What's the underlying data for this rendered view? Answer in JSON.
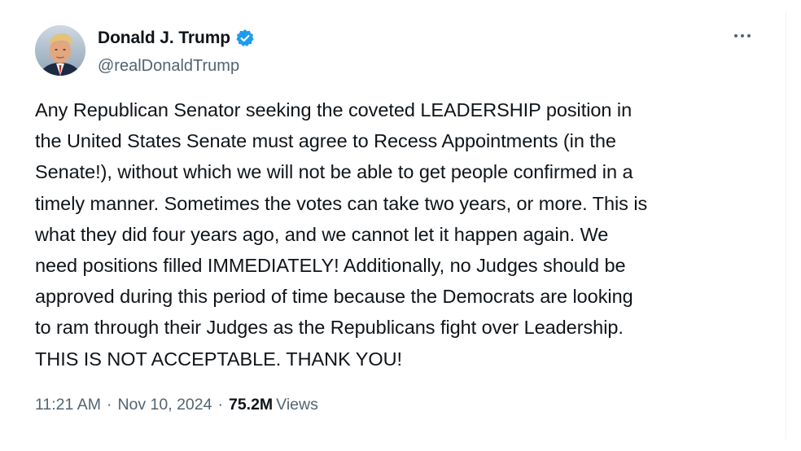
{
  "author": {
    "display_name": "Donald J. Trump",
    "handle": "@realDonaldTrump",
    "verified": true
  },
  "post": {
    "text": "Any Republican Senator seeking the coveted LEADERSHIP position in\nthe United States Senate must agree to Recess Appointments (in the\nSenate!), without which we will not be able to get people confirmed in a\ntimely manner. Sometimes the votes can take two years, or more. This is\nwhat they did four years ago, and we cannot let it happen again. We\nneed positions filled IMMEDIATELY! Additionally, no Judges should be\napproved during this period of time because the Democrats are looking\nto ram through their Judges as the Republicans fight over Leadership.\nTHIS IS NOT ACCEPTABLE. THANK YOU!",
    "time": "11:21 AM",
    "separator": "·",
    "date": "Nov 10, 2024",
    "views_count": "75.2M",
    "views_label": "Views"
  },
  "icons": {
    "more": "more-horizontal-icon",
    "verified": "verified-badge-icon"
  },
  "colors": {
    "text_primary": "#0f1419",
    "text_secondary": "#536471",
    "verified_blue": "#1d9bf0"
  }
}
